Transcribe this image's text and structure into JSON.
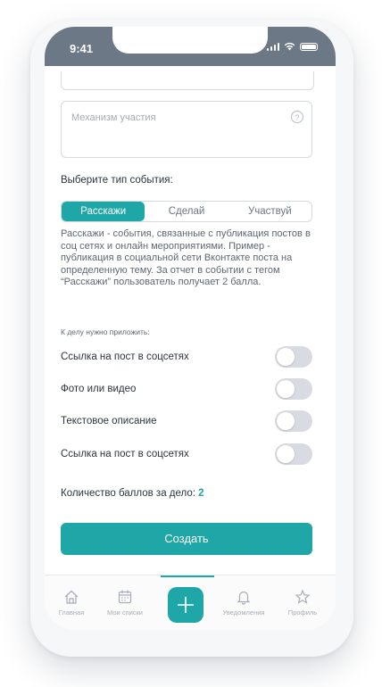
{
  "status": {
    "time": "9:41"
  },
  "form": {
    "mechanism_placeholder": "Механизм участия",
    "help_glyph": "?",
    "event_type_title": "Выберите тип события:",
    "segments": [
      "Расскажи",
      "Сделай",
      "Участвуй"
    ],
    "selected_segment": "Расскажи",
    "description": "Расскажи - события, связанные с публикация постов в соц сетях и онлайн мероприятиями. Пример - публикация в социальной сети Вконтакте поста на определенную тему. За отчет в событии с тегом “Расскажи” пользователь получает 2 балла.",
    "attach_title": "К делу нужно приложить:",
    "attachments": [
      {
        "label": "Ссылка на пост в соцсетях",
        "enabled": false
      },
      {
        "label": "Фото или видео",
        "enabled": false
      },
      {
        "label": "Текстовое описание",
        "enabled": false
      },
      {
        "label": "Ссылка на пост в соцсетях",
        "enabled": false
      }
    ],
    "points_label": "Количество баллов за дело:",
    "points_value": "2",
    "create_label": "Создать"
  },
  "tabbar": {
    "items": [
      {
        "label": "Главная",
        "icon": "home-icon"
      },
      {
        "label": "Мои списки",
        "icon": "calendar-icon"
      },
      {
        "label": "",
        "icon": "plus-icon"
      },
      {
        "label": "Уведомления",
        "icon": "bell-icon"
      },
      {
        "label": "Профиль",
        "icon": "star-icon"
      }
    ]
  },
  "colors": {
    "accent": "#1ea7a6",
    "statusbar": "#6c7886",
    "toggle_off": "#d9dbe2"
  }
}
